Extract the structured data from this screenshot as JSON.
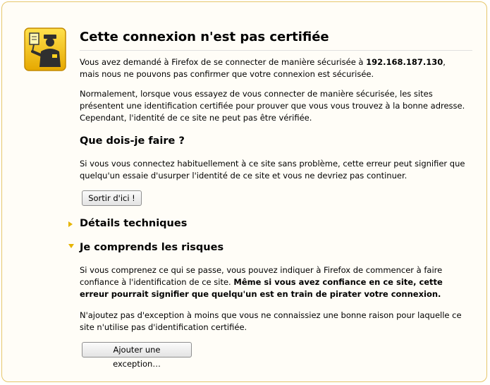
{
  "title": "Cette connexion n'est pas certifiée",
  "intro": {
    "before": "Vous avez demandé à Firefox de se connecter de manière sécurisée à ",
    "host": "192.168.187.130",
    "after": ", mais nous ne pouvons pas confirmer que votre connexion est sécurisée."
  },
  "normal_text": "Normalement, lorsque vous essayez de vous connecter de manière sécurisée, les sites présentent une identification certifiée pour prouver que vous vous trouvez à la bonne adresse. Cependant, l'identité de ce site ne peut pas être vérifiée.",
  "what_to_do": {
    "heading": "Que dois-je faire ?",
    "text": "Si vous vous connectez habituellement à ce site sans problème, cette erreur peut signifier que quelqu'un essaie d'usurper l'identité de ce site et vous ne devriez pas continuer.",
    "button": "Sortir d'ici !"
  },
  "technical": {
    "heading": "Détails techniques",
    "arrow_icon": "triangle-right"
  },
  "risks": {
    "heading": "Je comprends les risques",
    "arrow_icon": "triangle-down",
    "text_before": "Si vous comprenez ce qui se passe, vous pouvez indiquer à Firefox de commencer à faire confiance à l'identification de ce site. ",
    "text_bold": "Même si vous avez confiance en ce site, cette erreur pourrait signifier que quelqu'un est en train de pirater votre connexion.",
    "text2": "N'ajoutez pas d'exception à moins que vous ne connaissiez une bonne raison pour laquelle ce site n'utilise pas d'identification certifiée.",
    "button": "Ajouter une exception…"
  },
  "colors": {
    "accent": "#e6b400",
    "frame_border": "#e6c66a",
    "icon_bg": "#f2c400"
  },
  "icon": "officer-badge-icon"
}
